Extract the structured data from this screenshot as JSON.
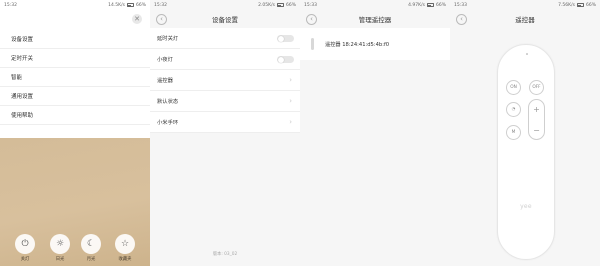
{
  "panel1": {
    "status": {
      "time": "15:32",
      "right": "14.5K/s"
    },
    "close_glyph": "✕",
    "menu": [
      "设备设置",
      "定时开关",
      "智能",
      "通用设置",
      "使用帮助"
    ],
    "buttons": [
      {
        "icon": "power-icon",
        "glyph": "⏻",
        "label": "关灯"
      },
      {
        "icon": "sun-icon",
        "glyph": "☼",
        "label": "日光"
      },
      {
        "icon": "moon-icon",
        "glyph": "☾",
        "label": "月光"
      },
      {
        "icon": "star-icon",
        "glyph": "☆",
        "label": "收藏夹"
      }
    ]
  },
  "panel2": {
    "status": {
      "time": "15:32",
      "right": "2.05K/s"
    },
    "title": "设备设置",
    "rows": [
      {
        "label": "延时关灯",
        "control": "toggle",
        "on": false
      },
      {
        "label": "小夜灯",
        "control": "toggle",
        "on": false
      },
      {
        "label": "遥控器",
        "control": "chevron"
      },
      {
        "label": "默认状态",
        "control": "chevron"
      },
      {
        "label": "小米手环",
        "control": "chevron"
      }
    ],
    "version": "版本: 03_02"
  },
  "panel3": {
    "status": {
      "time": "15:33",
      "right": "4.97K/s"
    },
    "title": "管理遥控器",
    "device_label": "遥控器 18:24:41:d5:4b:f0"
  },
  "panel4": {
    "status": {
      "time": "15:33",
      "right": "7.56K/s"
    },
    "title": "遥控器",
    "remote": {
      "on_label": "ON",
      "off_label": "OFF",
      "mode_glyph": "◔",
      "m_label": "M",
      "plus": "+",
      "minus": "−",
      "logo": "yee"
    }
  },
  "battery": "66%",
  "back_glyph": "‹",
  "chevron_glyph": "›"
}
